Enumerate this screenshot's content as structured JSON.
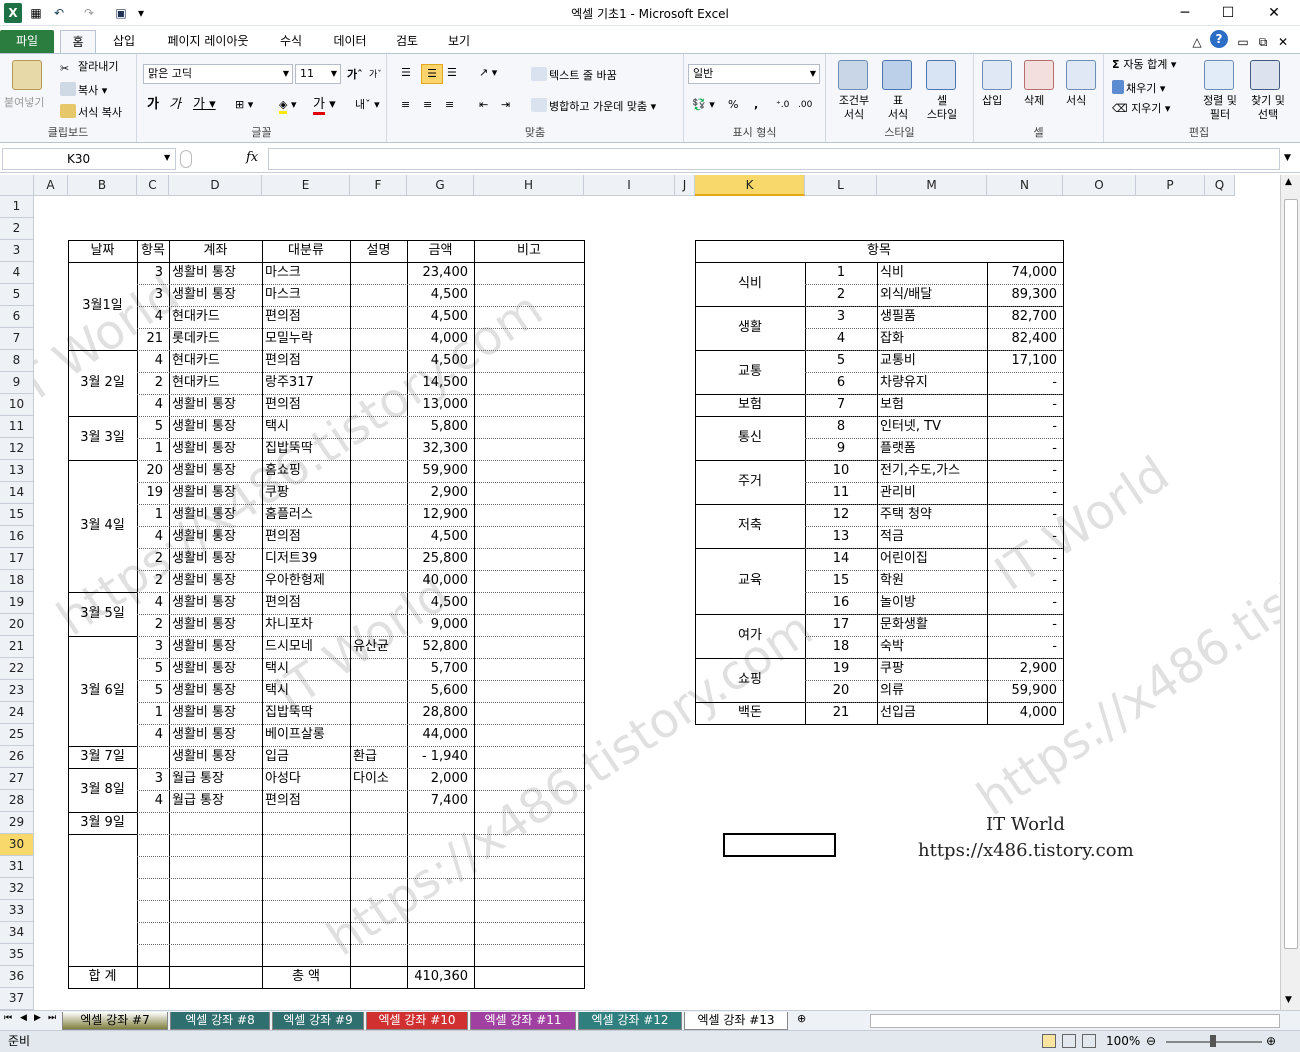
{
  "window": {
    "title": "엑셀 기초1  -  Microsoft Excel"
  },
  "tabs": [
    "파일",
    "홈",
    "삽입",
    "페이지 레이아웃",
    "수식",
    "데이터",
    "검토",
    "보기"
  ],
  "ribbon": {
    "clipboard": {
      "paste": "붙여넣기",
      "cut": "잘라내기",
      "copy": "복사",
      "format_painter": "서식 복사",
      "name": "클립보드"
    },
    "font": {
      "face": "맑은 고딕",
      "size": "11",
      "name": "글꼴"
    },
    "align": {
      "wrap": "텍스트 줄 바꿈",
      "merge": "병합하고 가운데 맞춤",
      "name": "맞춤"
    },
    "number": {
      "format": "일반",
      "name": "표시 형식"
    },
    "styles": {
      "cond": "조건부\n서식",
      "table": "표\n서식",
      "cell": "셀\n스타일",
      "name": "스타일"
    },
    "cells": {
      "insert": "삽입",
      "delete": "삭제",
      "format": "서식",
      "name": "셀"
    },
    "edit": {
      "autosum": "자동 합계",
      "fill": "채우기",
      "clear": "지우기",
      "sort": "정렬 및\n필터",
      "find": "찾기 및\n선택",
      "name": "편집"
    }
  },
  "formula_bar": {
    "name_box": "K30",
    "fx": "fx",
    "value": ""
  },
  "columns": [
    "A",
    "B",
    "C",
    "D",
    "E",
    "F",
    "G",
    "H",
    "I",
    "J",
    "K",
    "L",
    "M",
    "N",
    "O",
    "P",
    "Q"
  ],
  "rows": [
    "1",
    "2",
    "3",
    "4",
    "5",
    "6",
    "7",
    "8",
    "9",
    "10",
    "11",
    "12",
    "13",
    "14",
    "15",
    "16",
    "17",
    "18",
    "19",
    "20",
    "21",
    "22",
    "23",
    "24",
    "25",
    "26",
    "27",
    "28",
    "29",
    "30",
    "31",
    "32",
    "33",
    "34",
    "35",
    "36",
    "37"
  ],
  "ledger": {
    "headers": [
      "날짜",
      "항목",
      "계좌",
      "대분류",
      "설명",
      "금액",
      "비고"
    ],
    "dates": [
      {
        "label": "3월1일",
        "row_start": 4,
        "row_end": 7
      },
      {
        "label": "3월 2일",
        "row_start": 8,
        "row_end": 10
      },
      {
        "label": "3월 3일",
        "row_start": 11,
        "row_end": 12
      },
      {
        "label": "3월 4일",
        "row_start": 13,
        "row_end": 18
      },
      {
        "label": "3월 5일",
        "row_start": 19,
        "row_end": 20
      },
      {
        "label": "3월 6일",
        "row_start": 21,
        "row_end": 25
      },
      {
        "label": "3월 7일",
        "row_start": 26,
        "row_end": 26
      },
      {
        "label": "3월 8일",
        "row_start": 27,
        "row_end": 28
      },
      {
        "label": "3월 9일",
        "row_start": 29,
        "row_end": 29
      }
    ],
    "rows": [
      {
        "row": 4,
        "item": "3",
        "account": "생활비 통장",
        "category": "마스크",
        "desc": "",
        "amount": "23,400"
      },
      {
        "row": 5,
        "item": "3",
        "account": "생활비 통장",
        "category": "마스크",
        "desc": "",
        "amount": "4,500"
      },
      {
        "row": 6,
        "item": "4",
        "account": "현대카드",
        "category": "편의점",
        "desc": "",
        "amount": "4,500"
      },
      {
        "row": 7,
        "item": "21",
        "account": "롯데카드",
        "category": "모밀누락",
        "desc": "",
        "amount": "4,000"
      },
      {
        "row": 8,
        "item": "4",
        "account": "현대카드",
        "category": "편의점",
        "desc": "",
        "amount": "4,500"
      },
      {
        "row": 9,
        "item": "2",
        "account": "현대카드",
        "category": "랑주317",
        "desc": "",
        "amount": "14,500"
      },
      {
        "row": 10,
        "item": "4",
        "account": "생활비 통장",
        "category": "편의점",
        "desc": "",
        "amount": "13,000"
      },
      {
        "row": 11,
        "item": "5",
        "account": "생활비 통장",
        "category": "택시",
        "desc": "",
        "amount": "5,800"
      },
      {
        "row": 12,
        "item": "1",
        "account": "생활비 통장",
        "category": "집밥뚝딱",
        "desc": "",
        "amount": "32,300"
      },
      {
        "row": 13,
        "item": "20",
        "account": "생활비 통장",
        "category": "홈쇼핑",
        "desc": "",
        "amount": "59,900"
      },
      {
        "row": 14,
        "item": "19",
        "account": "생활비 통장",
        "category": "쿠팡",
        "desc": "",
        "amount": "2,900"
      },
      {
        "row": 15,
        "item": "1",
        "account": "생활비 통장",
        "category": "홈플러스",
        "desc": "",
        "amount": "12,900"
      },
      {
        "row": 16,
        "item": "4",
        "account": "생활비 통장",
        "category": "편의점",
        "desc": "",
        "amount": "4,500"
      },
      {
        "row": 17,
        "item": "2",
        "account": "생활비 통장",
        "category": "디저트39",
        "desc": "",
        "amount": "25,800"
      },
      {
        "row": 18,
        "item": "2",
        "account": "생활비 통장",
        "category": "우아한형제",
        "desc": "",
        "amount": "40,000"
      },
      {
        "row": 19,
        "item": "4",
        "account": "생활비 통장",
        "category": "편의점",
        "desc": "",
        "amount": "4,500"
      },
      {
        "row": 20,
        "item": "2",
        "account": "생활비 통장",
        "category": "차니포차",
        "desc": "",
        "amount": "9,000"
      },
      {
        "row": 21,
        "item": "3",
        "account": "생활비 통장",
        "category": "드시모네",
        "desc": "유산균",
        "amount": "52,800"
      },
      {
        "row": 22,
        "item": "5",
        "account": "생활비 통장",
        "category": "택시",
        "desc": "",
        "amount": "5,700"
      },
      {
        "row": 23,
        "item": "5",
        "account": "생활비 통장",
        "category": "택시",
        "desc": "",
        "amount": "5,600"
      },
      {
        "row": 24,
        "item": "1",
        "account": "생활비 통장",
        "category": "집밥뚝딱",
        "desc": "",
        "amount": "28,800"
      },
      {
        "row": 25,
        "item": "4",
        "account": "생활비 통장",
        "category": "베이프살롱",
        "desc": "",
        "amount": "44,000"
      },
      {
        "row": 26,
        "item": "",
        "account": "생활비 통장",
        "category": "입금",
        "desc": "환급",
        "amount": "-   1,940"
      },
      {
        "row": 27,
        "item": "3",
        "account": "월급 통장",
        "category": "아성다",
        "desc": "다이소",
        "amount": "2,000"
      },
      {
        "row": 28,
        "item": "4",
        "account": "월급 통장",
        "category": "편의점",
        "desc": "",
        "amount": "7,400"
      }
    ],
    "total_label": "합  계",
    "total_amount_label": "총  액",
    "total": "410,360"
  },
  "summary": {
    "header": "항목",
    "groups": [
      {
        "name": "식비",
        "row_start": 4,
        "row_end": 5
      },
      {
        "name": "생활",
        "row_start": 6,
        "row_end": 7
      },
      {
        "name": "교통",
        "row_start": 8,
        "row_end": 9
      },
      {
        "name": "보험",
        "row_start": 10,
        "row_end": 10
      },
      {
        "name": "통신",
        "row_start": 11,
        "row_end": 12
      },
      {
        "name": "주거",
        "row_start": 13,
        "row_end": 14
      },
      {
        "name": "저축",
        "row_start": 15,
        "row_end": 16
      },
      {
        "name": "교육",
        "row_start": 17,
        "row_end": 19
      },
      {
        "name": "여가",
        "row_start": 20,
        "row_end": 21
      },
      {
        "name": "쇼핑",
        "row_start": 22,
        "row_end": 23
      },
      {
        "name": "백돈",
        "row_start": 24,
        "row_end": 24
      }
    ],
    "rows": [
      {
        "row": 4,
        "no": "1",
        "name": "식비",
        "amount": "74,000"
      },
      {
        "row": 5,
        "no": "2",
        "name": "외식/배달",
        "amount": "89,300"
      },
      {
        "row": 6,
        "no": "3",
        "name": "생필품",
        "amount": "82,700"
      },
      {
        "row": 7,
        "no": "4",
        "name": "잡화",
        "amount": "82,400"
      },
      {
        "row": 8,
        "no": "5",
        "name": "교통비",
        "amount": "17,100"
      },
      {
        "row": 9,
        "no": "6",
        "name": "차량유지",
        "amount": "-"
      },
      {
        "row": 10,
        "no": "7",
        "name": "보험",
        "amount": "-"
      },
      {
        "row": 11,
        "no": "8",
        "name": "인터넷, TV",
        "amount": "-"
      },
      {
        "row": 12,
        "no": "9",
        "name": "플랫폼",
        "amount": "-"
      },
      {
        "row": 13,
        "no": "10",
        "name": "전기,수도,가스",
        "amount": "-"
      },
      {
        "row": 14,
        "no": "11",
        "name": "관리비",
        "amount": "-"
      },
      {
        "row": 15,
        "no": "12",
        "name": "주택 청약",
        "amount": "-"
      },
      {
        "row": 16,
        "no": "13",
        "name": "적금",
        "amount": "-"
      },
      {
        "row": 17,
        "no": "14",
        "name": "어린이집",
        "amount": "-"
      },
      {
        "row": 18,
        "no": "15",
        "name": "학원",
        "amount": "-"
      },
      {
        "row": 19,
        "no": "16",
        "name": "놀이방",
        "amount": "-"
      },
      {
        "row": 20,
        "no": "17",
        "name": "문화생활",
        "amount": "-"
      },
      {
        "row": 21,
        "no": "18",
        "name": "숙박",
        "amount": "-"
      },
      {
        "row": 22,
        "no": "19",
        "name": "쿠팡",
        "amount": "2,900"
      },
      {
        "row": 23,
        "no": "20",
        "name": "의류",
        "amount": "59,900"
      },
      {
        "row": 24,
        "no": "21",
        "name": "선입금",
        "amount": "4,000"
      }
    ]
  },
  "signature": {
    "line1": "IT World",
    "line2": "https://x486.tistory.com"
  },
  "watermarks": [
    "IT World",
    "https://x486.tistory.com",
    "IT World",
    "https://x486.tistory.com",
    "IT World",
    "https://x486.tistory.com"
  ],
  "sheets": [
    {
      "name": "엑셀 강좌 #7",
      "color": "#7f7f3f"
    },
    {
      "name": "엑셀 강좌 #8",
      "color": "#2f6f6f"
    },
    {
      "name": "엑셀 강좌 #9",
      "color": "#2f6f6f"
    },
    {
      "name": "엑셀 강좌 #10",
      "color": "#d03030"
    },
    {
      "name": "엑셀 강좌 #11",
      "color": "#a040a0"
    },
    {
      "name": "엑셀 강좌 #12",
      "color": "#2f7f7f"
    },
    {
      "name": "엑셀 강좌 #13",
      "color": "#ffffff"
    }
  ],
  "status": {
    "ready": "준비",
    "zoom": "100%"
  },
  "accent": {
    "file_tab": "#2a7d3f",
    "selection": "#f8d86a"
  }
}
